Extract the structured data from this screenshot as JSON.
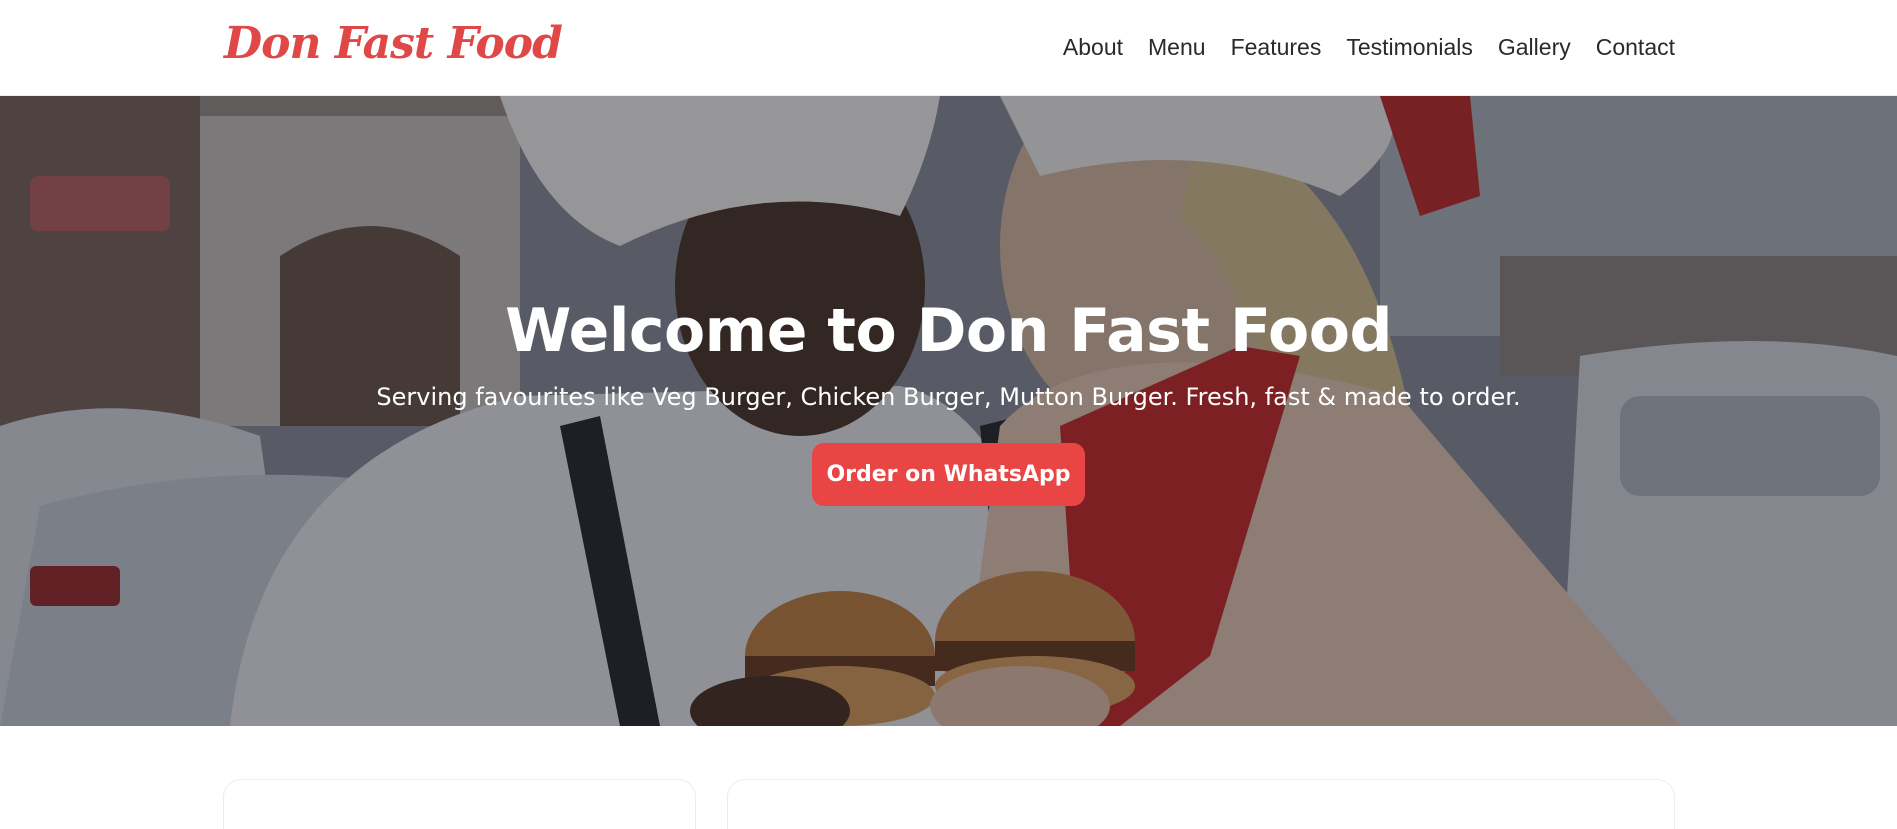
{
  "brand": {
    "name": "Don Fast Food",
    "accent_color": "#ea4545"
  },
  "nav": {
    "items": [
      {
        "label": "About"
      },
      {
        "label": "Menu"
      },
      {
        "label": "Features"
      },
      {
        "label": "Testimonials"
      },
      {
        "label": "Gallery"
      },
      {
        "label": "Contact"
      }
    ]
  },
  "hero": {
    "title": "Welcome to Don Fast Food",
    "subtitle": "Serving favourites like Veg Burger, Chicken Burger, Mutton Burger. Fresh, fast & made to order.",
    "cta_label": "Order on WhatsApp",
    "background_image": "hero-photo"
  }
}
